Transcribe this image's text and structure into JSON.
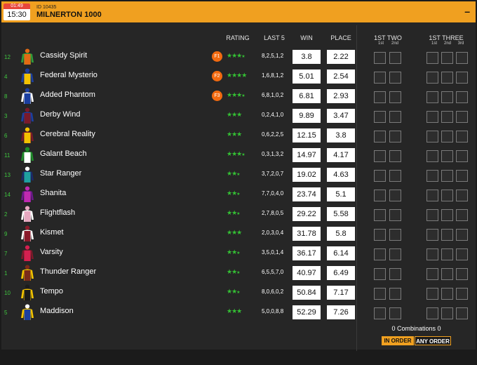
{
  "race": {
    "countdown": "01:49",
    "time": "15:30",
    "id_label": "ID 10435",
    "name": "MILNERTON 1000",
    "collapse_label": "–"
  },
  "columns": {
    "rating": "RATING",
    "last5": "LAST 5",
    "win": "WIN",
    "place": "PLACE",
    "first_two": "1ST TWO",
    "first_three": "1ST THREE",
    "sub_1st": "1st",
    "sub_2nd": "2nd",
    "sub_3rd": "3rd"
  },
  "colors": {
    "accent": "#f0a020",
    "favorite_badge": "#f26a10",
    "rating_star": "#34c034",
    "number_text": "#3fc43f"
  },
  "runners": [
    {
      "number": "12",
      "name": "Cassidy Spirit",
      "favorite": "F1",
      "rating": 3.5,
      "last5": "8,2,5,1,2",
      "win": "3.8",
      "place": "2.22",
      "silk": {
        "body": "#e36a14",
        "sleeves": "#2f9a3a",
        "cap": "#e36a14"
      }
    },
    {
      "number": "4",
      "name": "Federal Mysterio",
      "favorite": "F2",
      "rating": 4,
      "last5": "1,6,8,1,2",
      "win": "5.01",
      "place": "2.54",
      "silk": {
        "body": "#f2c200",
        "sleeves": "#1b3fa0",
        "cap": "#1b3fa0"
      }
    },
    {
      "number": "8",
      "name": "Added Phantom",
      "favorite": "F3",
      "rating": 3.5,
      "last5": "6,8,1,0,2",
      "win": "6.81",
      "place": "2.93",
      "silk": {
        "body": "#1b3fa0",
        "sleeves": "#ffffff",
        "cap": "#1b3fa0"
      }
    },
    {
      "number": "3",
      "name": "Derby Wind",
      "favorite": "",
      "rating": 3,
      "last5": "0,2,4,1,0",
      "win": "9.89",
      "place": "3.47",
      "silk": {
        "body": "#7a1a2a",
        "sleeves": "#1b3fa0",
        "cap": "#7a1a2a"
      }
    },
    {
      "number": "6",
      "name": "Cerebral Reality",
      "favorite": "",
      "rating": 3,
      "last5": "0,6,2,2,5",
      "win": "12.15",
      "place": "3.8",
      "silk": {
        "body": "#f2c200",
        "sleeves": "#7a1a2a",
        "cap": "#f2c200"
      }
    },
    {
      "number": "11",
      "name": "Galant Beach",
      "favorite": "",
      "rating": 3.5,
      "last5": "0,3,1,3,2",
      "win": "14.97",
      "place": "4.17",
      "silk": {
        "body": "#ffffff",
        "sleeves": "#1f8f2a",
        "cap": "#1f8f2a"
      }
    },
    {
      "number": "13",
      "name": "Star Ranger",
      "favorite": "",
      "rating": 2.5,
      "last5": "3,7,2,0,7",
      "win": "19.02",
      "place": "4.63",
      "silk": {
        "body": "#1fa0a0",
        "sleeves": "#1b2a6a",
        "cap": "#ffffff"
      }
    },
    {
      "number": "14",
      "name": "Shanita",
      "favorite": "",
      "rating": 2.5,
      "last5": "7,7,0,4,0",
      "win": "23.74",
      "place": "5.1",
      "silk": {
        "body": "#c02ab0",
        "sleeves": "#6a1a8a",
        "cap": "#c02ab0"
      }
    },
    {
      "number": "2",
      "name": "Flightflash",
      "favorite": "",
      "rating": 2.5,
      "last5": "2,7,8,0,5",
      "win": "29.22",
      "place": "5.58",
      "silk": {
        "body": "#e6a8c0",
        "sleeves": "#ffffff",
        "cap": "#e6a8c0"
      }
    },
    {
      "number": "9",
      "name": "Kismet",
      "favorite": "",
      "rating": 3,
      "last5": "2,0,3,0,4",
      "win": "31.78",
      "place": "5.8",
      "silk": {
        "body": "#8a1a2a",
        "sleeves": "#ffffff",
        "cap": "#8a1a2a"
      }
    },
    {
      "number": "7",
      "name": "Varsity",
      "favorite": "",
      "rating": 2.5,
      "last5": "3,5,0,1,4",
      "win": "36.17",
      "place": "6.14",
      "silk": {
        "body": "#d42050",
        "sleeves": "#7a1a2a",
        "cap": "#d42050"
      }
    },
    {
      "number": "1",
      "name": "Thunder Ranger",
      "favorite": "",
      "rating": 2.5,
      "last5": "6,5,5,7,0",
      "win": "40.97",
      "place": "6.49",
      "silk": {
        "body": "#7a2a1a",
        "sleeves": "#f2c200",
        "cap": "#7a2a1a"
      }
    },
    {
      "number": "10",
      "name": "Tempo",
      "favorite": "",
      "rating": 2.5,
      "last5": "8,0,6,0,2",
      "win": "50.84",
      "place": "7.17",
      "silk": {
        "body": "#1b1b1b",
        "sleeves": "#f2c200",
        "cap": "#1b1b1b"
      }
    },
    {
      "number": "5",
      "name": "Maddison",
      "favorite": "",
      "rating": 3,
      "last5": "5,0,0,8,8",
      "win": "52.29",
      "place": "7.26",
      "silk": {
        "body": "#1b3fa0",
        "sleeves": "#f2c200",
        "cap": "#ffffff"
      }
    }
  ],
  "footer": {
    "combinations": "0 Combinations 0",
    "in_order": "IN ORDER",
    "any_order": "ANY ORDER",
    "active_order": "in_order"
  }
}
